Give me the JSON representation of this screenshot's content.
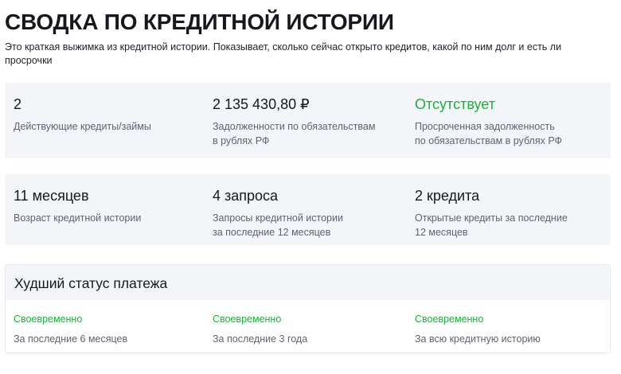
{
  "header": {
    "title": "СВОДКА ПО КРЕДИТНОЙ ИСТОРИИ",
    "description": "Это краткая выжимка из кредитной истории. Показывает, сколько сейчас открыто кредитов, какой по ним долг и есть ли просрочки"
  },
  "summary_row_1": [
    {
      "value": "2",
      "label": "Действующие кредиты/займы"
    },
    {
      "value": "2 135 430,80 ₽",
      "label": "Задолженности по обязательствам\nв рублях РФ"
    },
    {
      "value": "Отсутствует",
      "label": "Просроченная задолженность\nпо обязательствам в рублях РФ"
    }
  ],
  "summary_row_2": [
    {
      "value": "11 месяцев",
      "label": "Возраст кредитной истории"
    },
    {
      "value": "4 запроса",
      "label": "Запросы кредитной истории\nза последние 12 месяцев"
    },
    {
      "value": "2 кредита",
      "label": "Открытые кредиты за последние\n12 месяцев"
    }
  ],
  "worst_status": {
    "title": "Худший статус платежа",
    "items": [
      {
        "status": "Своевременно",
        "period": "За последние 6 месяцев"
      },
      {
        "status": "Своевременно",
        "period": "За последние 3 года"
      },
      {
        "status": "Своевременно",
        "period": "За всю кредитную историю"
      }
    ]
  },
  "colors": {
    "positive": "#1fae3b",
    "card_background": "#f3f5f9",
    "muted_text": "#5d6370"
  }
}
